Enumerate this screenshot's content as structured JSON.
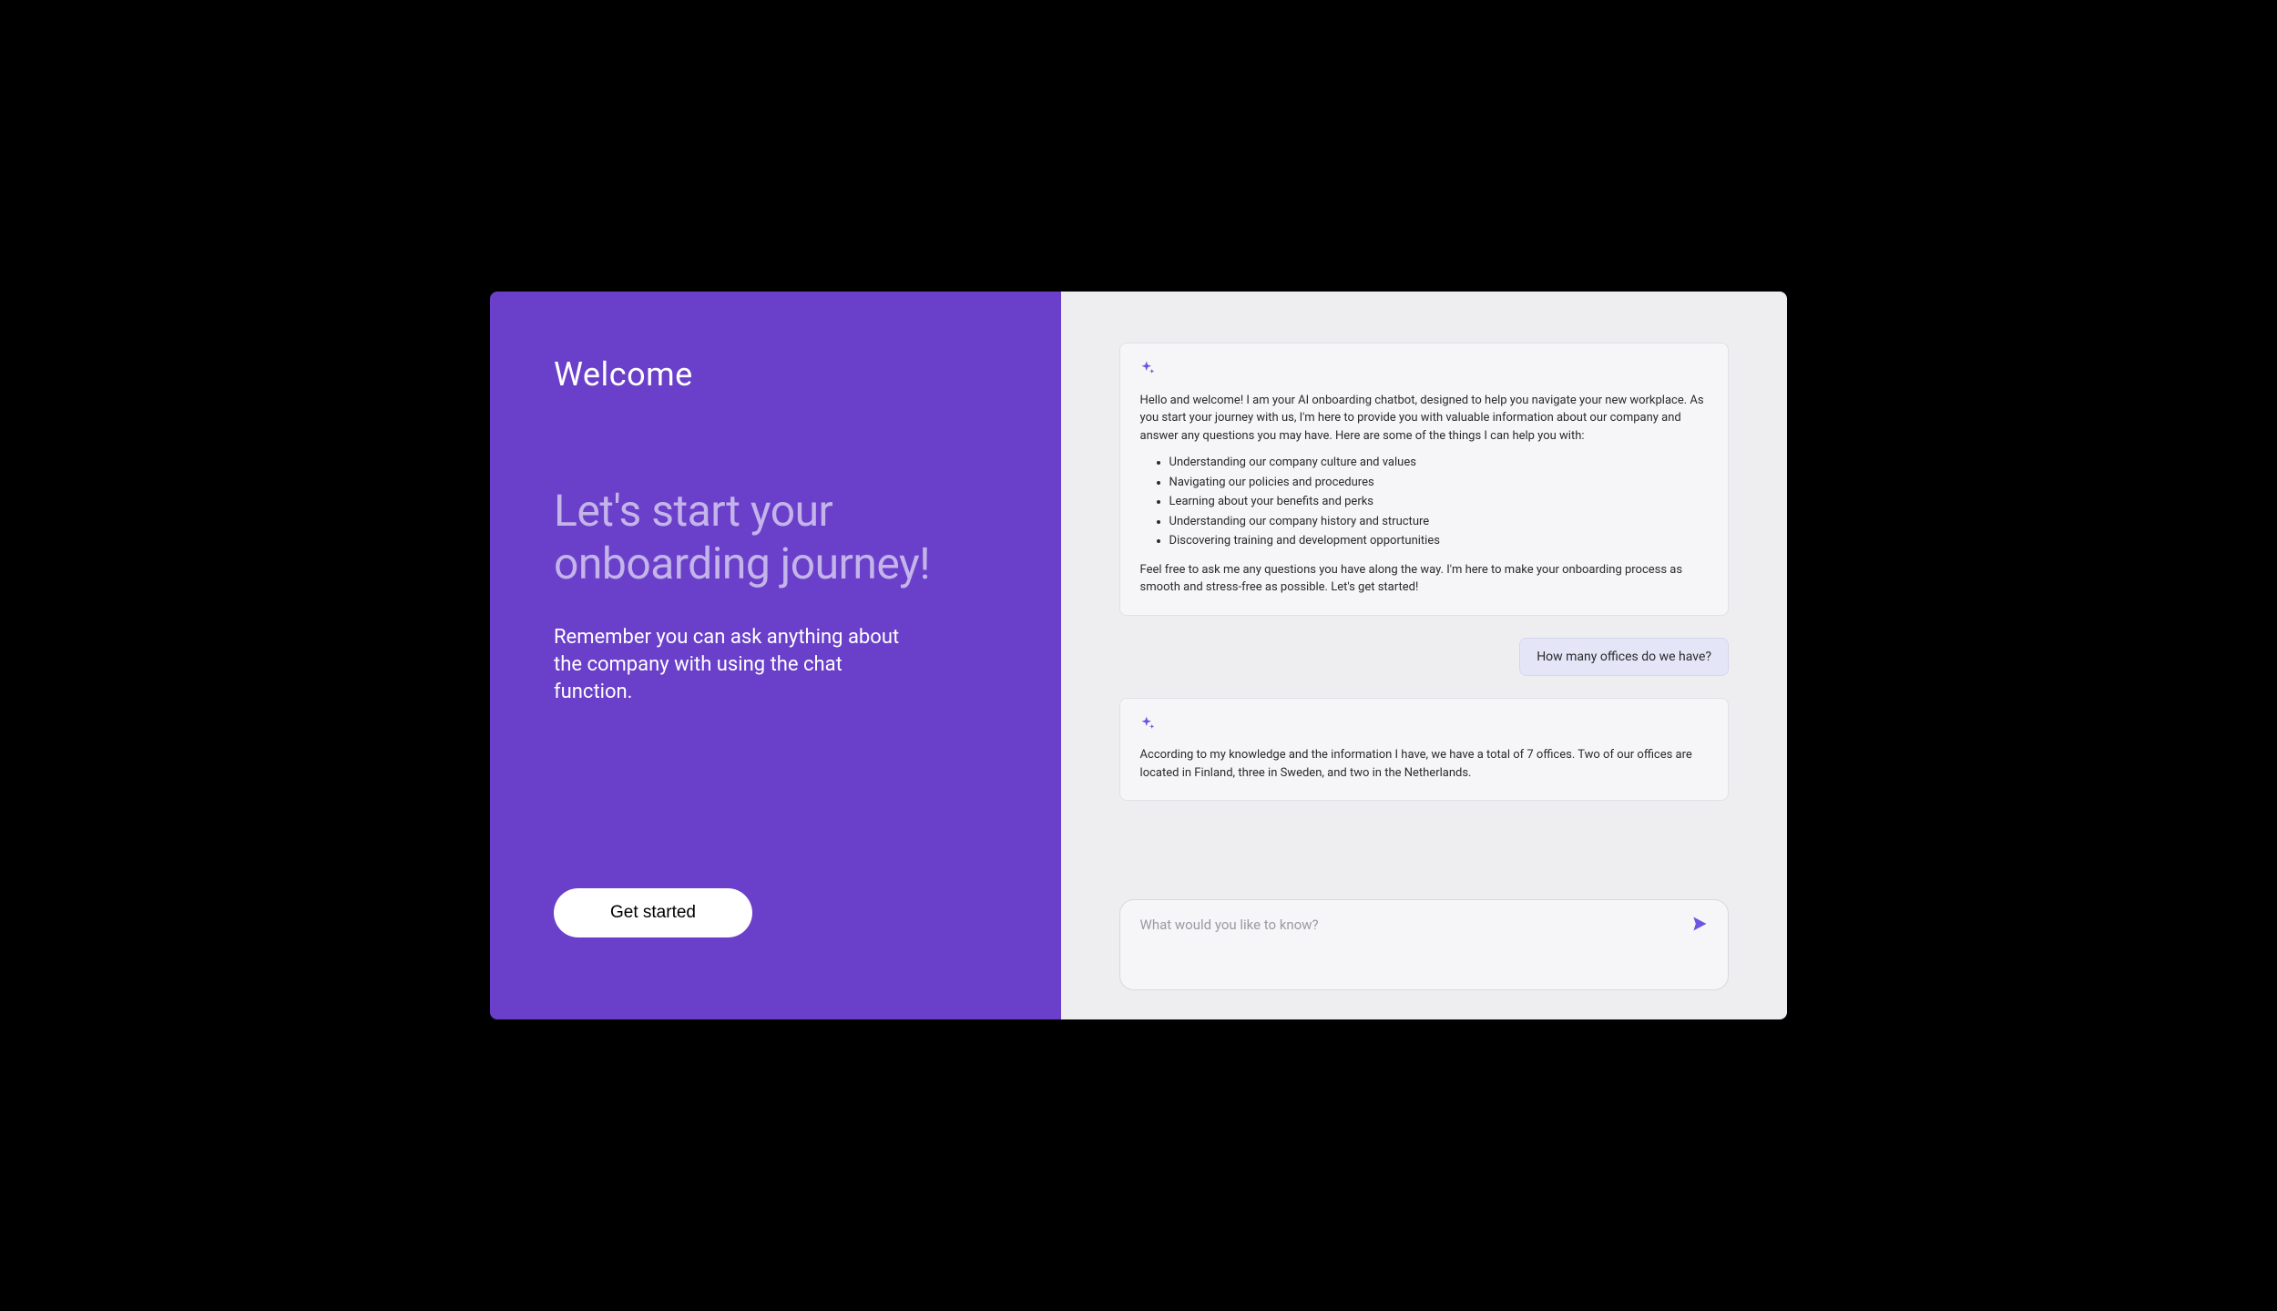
{
  "left": {
    "welcome": "Welcome",
    "headline": "Let's start your onboarding journey!",
    "subtext": "Remember you can ask anything about the company with using the chat function.",
    "cta": "Get started"
  },
  "chat": {
    "messages": [
      {
        "role": "bot",
        "intro": "Hello and welcome! I am your AI onboarding chatbot, designed to help you navigate your new workplace. As you start your journey with us, I'm here to provide you with valuable information about our company and answer any questions you may have. Here are some of the things I can help you with:",
        "bullets": [
          "Understanding our company culture and values",
          "Navigating our policies and procedures",
          "Learning about your benefits and perks",
          "Understanding our company history and structure",
          "Discovering training and development opportunities"
        ],
        "outro": "Feel free to ask me any questions you have along the way. I'm here to make your onboarding process as smooth and stress-free as possible. Let's get started!"
      },
      {
        "role": "user",
        "text": "How many offices do we have?"
      },
      {
        "role": "bot",
        "intro": "According to my knowledge and the information I have, we have a total of 7 offices. Two of our offices are located in Finland, three in Sweden, and two in the Netherlands."
      }
    ],
    "input_placeholder": "What would you like to know?"
  },
  "colors": {
    "accent": "#6a3fc9",
    "icon": "#6a56e0",
    "user_bubble": "#e4e6f8"
  }
}
